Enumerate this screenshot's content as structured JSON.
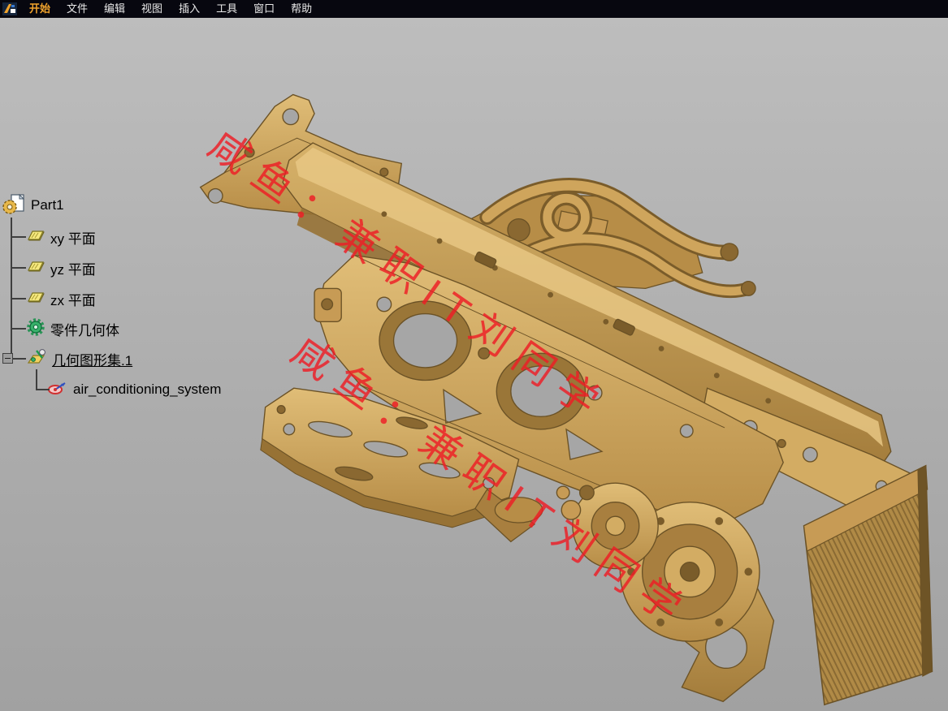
{
  "menubar": {
    "background": "#07070f",
    "start_item_color": "#f0a32c",
    "items": [
      {
        "label": "开始"
      },
      {
        "label": "文件"
      },
      {
        "label": "编辑"
      },
      {
        "label": "视图"
      },
      {
        "label": "插入"
      },
      {
        "label": "工具"
      },
      {
        "label": "窗口"
      },
      {
        "label": "帮助"
      }
    ]
  },
  "tree": {
    "root": {
      "label": "Part1",
      "icon": "part-document-icon"
    },
    "items": [
      {
        "label": "xy 平面",
        "icon": "plane-icon"
      },
      {
        "label": "yz 平面",
        "icon": "plane-icon"
      },
      {
        "label": "zx 平面",
        "icon": "plane-icon"
      },
      {
        "label": "零件几何体",
        "icon": "partbody-icon"
      },
      {
        "label": "几何图形集.1",
        "icon": "geometrical-set-icon",
        "underlined": true
      },
      {
        "label": "air_conditioning_system",
        "icon": "axis-system-icon"
      }
    ]
  },
  "viewport": {
    "background_top": "#bdbdbd",
    "background_bottom": "#a1a1a1",
    "model_color": "#c79b55"
  },
  "watermark": {
    "text": "咸鱼：兼职IT刘同学",
    "color": "#ee1c24"
  }
}
